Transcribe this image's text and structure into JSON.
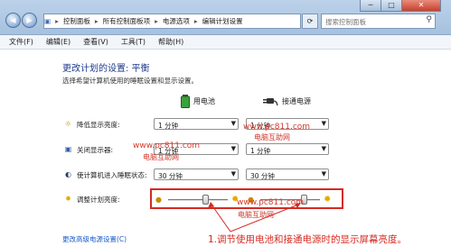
{
  "window": {
    "breadcrumb": [
      "控制面板",
      "所有控制面板项",
      "电源选项",
      "编辑计划设置"
    ],
    "search_placeholder": "搜索控制面板",
    "controls": {
      "minimize": "─",
      "maximize": "□",
      "close": "✕"
    }
  },
  "menu": [
    "文件(F)",
    "编辑(E)",
    "查看(V)",
    "工具(T)",
    "帮助(H)"
  ],
  "page": {
    "title": "更改计划的设置: 平衡",
    "description": "选择希望计算机使用的睡眠设置和显示设置。",
    "column_battery": "用电池",
    "column_plugged": "接通电源"
  },
  "settings": [
    {
      "label": "降低显示亮度:",
      "battery": "1 分钟",
      "plugged": "1 分钟"
    },
    {
      "label": "关闭显示器:",
      "battery": "1 分钟",
      "plugged": "1 分钟"
    },
    {
      "label": "使计算机进入睡眠状态:",
      "battery": "30 分钟",
      "plugged": "30 分钟"
    }
  ],
  "brightness": {
    "label": "调整计划亮度:",
    "battery_level": 0.62,
    "plugged_level": 0.72
  },
  "advanced_link": "更改高级电源设置(C)",
  "watermarks": {
    "url": "www.pc811.com",
    "site": "电脑互助网"
  },
  "annotation": "1.调节使用电池和接通电源时的显示屏幕亮度。",
  "colors": {
    "accent": "#1e3a8a",
    "highlight_border": "#d42a24",
    "link": "#1a5bc8"
  }
}
